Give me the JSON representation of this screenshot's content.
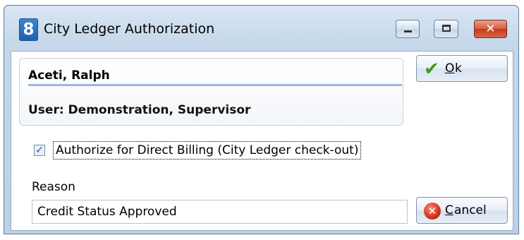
{
  "window": {
    "title": "City Ledger Authorization",
    "app_icon_text": "8",
    "accent": "#2f74c6",
    "close_color": "#c9381c"
  },
  "caption_buttons": {
    "minimize_icon": "minimize-icon",
    "maximize_icon": "maximize-icon",
    "close_icon": "close-icon",
    "close_glyph": "✕"
  },
  "info": {
    "guest_name": "Aceti, Ralph",
    "user": "User: Demonstration, Supervisor"
  },
  "authorize": {
    "checked": true,
    "check_glyph": "✓",
    "label": "Authorize for Direct Billing (City Ledger check-out)"
  },
  "reason": {
    "label": "Reason",
    "value": "Credit Status Approved"
  },
  "buttons": {
    "ok": {
      "mnemonic": "O",
      "rest": "k",
      "icon": "checkmark-icon",
      "glyph": "✔"
    },
    "cancel": {
      "mnemonic": "C",
      "rest": "ancel",
      "icon": "cancel-icon",
      "glyph": "✕"
    }
  }
}
